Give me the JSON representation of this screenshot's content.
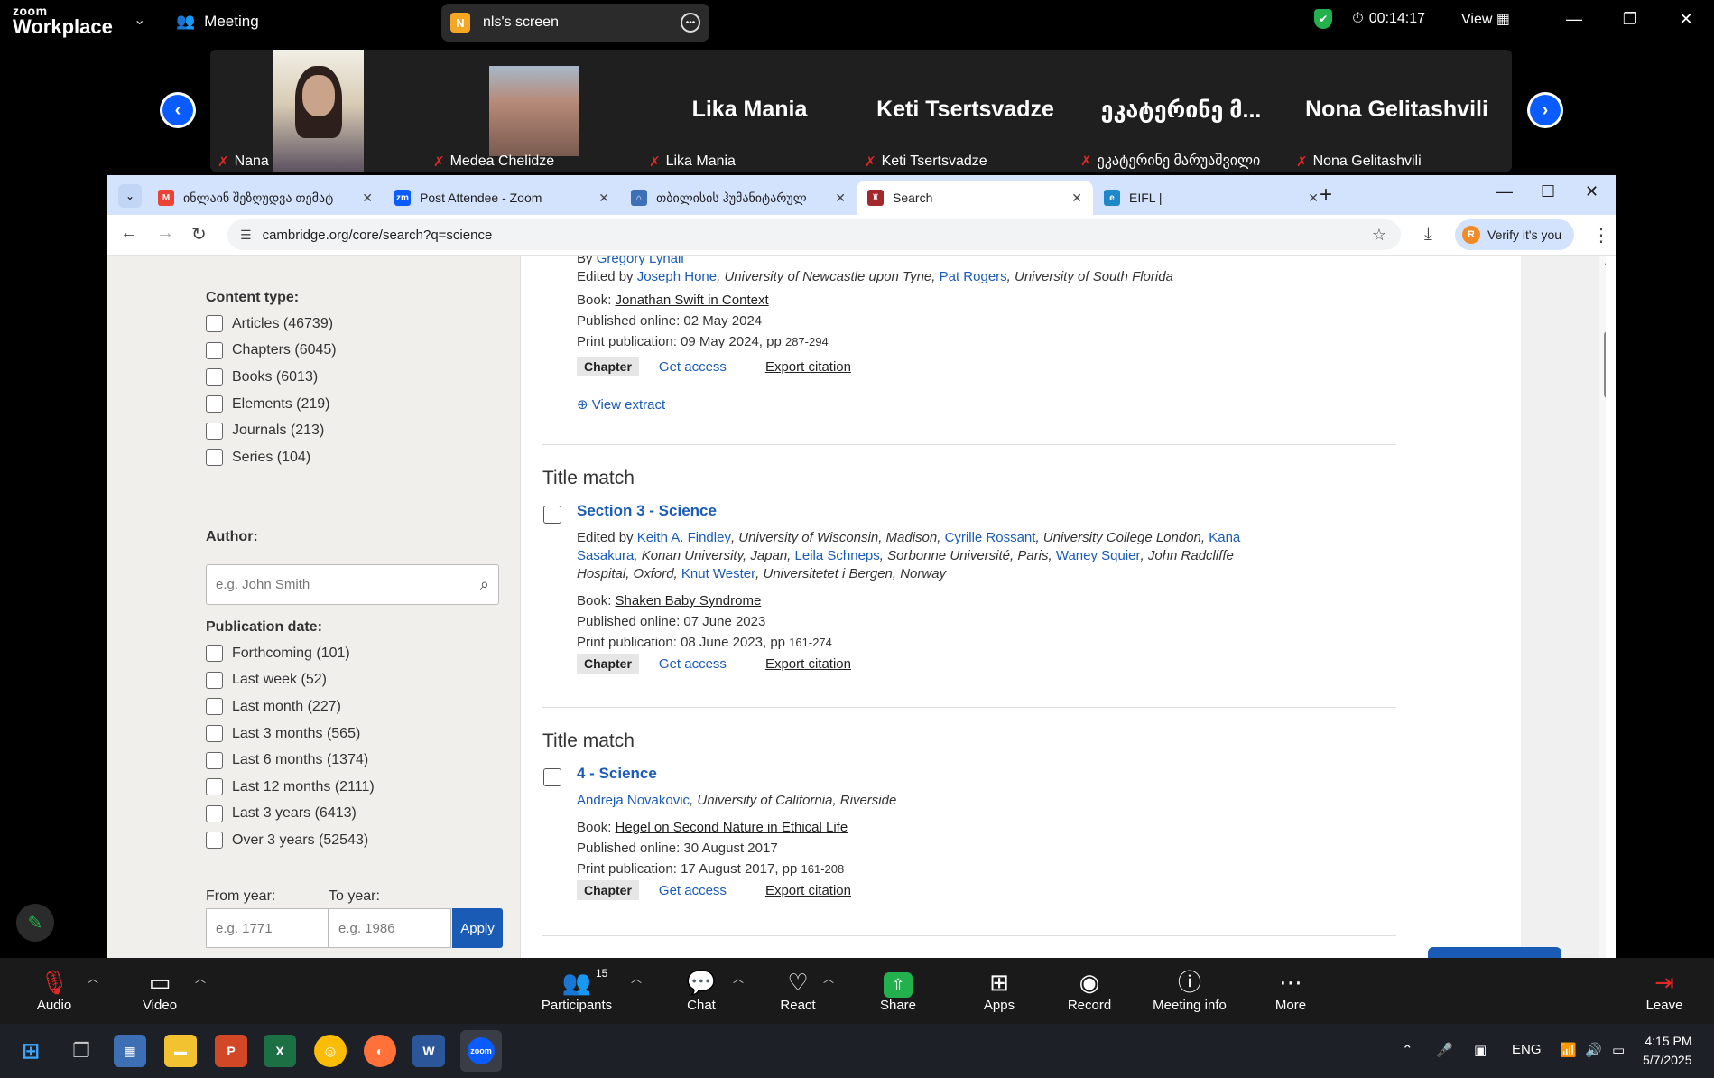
{
  "zoom": {
    "logo_small": "zoom",
    "logo_big": "Workplace",
    "meeting_label": "Meeting",
    "share_initial": "N",
    "share_title": "nls's screen",
    "timer": "00:14:17",
    "view_label": "View",
    "participants": [
      {
        "label": "Nana",
        "big_name": ""
      },
      {
        "label": "Medea Chelidze",
        "big_name": ""
      },
      {
        "label": "Lika Mania",
        "big_name": "Lika Mania"
      },
      {
        "label": "Keti Tsertsvadze",
        "big_name": "Keti Tsertsvadze"
      },
      {
        "label": "ეკატერინე მარუაშვილი",
        "big_name": "ეკატერინე მ..."
      },
      {
        "label": "Nona Gelitashvili",
        "big_name": "Nona Gelitashvili"
      }
    ],
    "toolbar": {
      "audio": "Audio",
      "video": "Video",
      "participants": "Participants",
      "participants_count": "15",
      "chat": "Chat",
      "react": "React",
      "share": "Share",
      "apps": "Apps",
      "record": "Record",
      "meeting_info": "Meeting info",
      "more": "More",
      "leave": "Leave"
    }
  },
  "browser": {
    "tabs": [
      {
        "title": "ინლაინ შეზღუდვა თემატ",
        "icon": "gmail-icon",
        "color": "#ea4335"
      },
      {
        "title": "Post Attendee - Zoom",
        "icon": "zoom-icon",
        "color": "#0b5cff"
      },
      {
        "title": "თბილისის ჰუმანიტარულ",
        "icon": "university-icon",
        "color": "#3b6fb6"
      },
      {
        "title": "Search",
        "icon": "cambridge-icon",
        "color": "#a3282e"
      },
      {
        "title": "EIFL |",
        "icon": "eifl-icon",
        "color": "#1e88c8"
      }
    ],
    "url": "cambridge.org/core/search?q=science",
    "verify_initial": "R",
    "verify_label": "Verify it's you"
  },
  "sidebar": {
    "content_type_heading": "Content type:",
    "content_types": [
      "Articles (46739)",
      "Chapters (6045)",
      "Books (6013)",
      "Elements (219)",
      "Journals (213)",
      "Series (104)"
    ],
    "author_heading": "Author:",
    "author_placeholder": "e.g. John Smith",
    "pubdate_heading": "Publication date:",
    "pubdates": [
      "Forthcoming (101)",
      "Last week (52)",
      "Last month (227)",
      "Last 3 months (565)",
      "Last 6 months (1374)",
      "Last 12 months (2111)",
      "Last 3 years (6413)",
      "Over 3 years (52543)"
    ],
    "from_label": "From year:",
    "from_placeholder": "e.g. 1771",
    "to_label": "To year:",
    "to_placeholder": "e.g. 1986",
    "apply_label": "Apply"
  },
  "results": {
    "r0": {
      "by_prefix": "By",
      "by_author": "Gregory Lynall",
      "edited_prefix": "Edited by",
      "editor1": "Joseph Hone",
      "editor1_aff": ", University of Newcastle upon Tyne,",
      "editor2": "Pat Rogers",
      "editor2_aff": ", University of South Florida",
      "book_prefix": "Book:",
      "book": "Jonathan Swift in Context",
      "published_online": "Published online: 02 May 2024",
      "print_pub": "Print publication: 09 May 2024, pp",
      "pages": "287-294",
      "badge": "Chapter",
      "get_access": "Get access",
      "export": "Export citation",
      "view_extract": "View extract"
    },
    "r1": {
      "match": "Title match",
      "title": "Section 3 - Science",
      "edited_prefix": "Edited by",
      "e1": "Keith A. Findley",
      "e1_aff": ", University of Wisconsin, Madison,",
      "e2": "Cyrille Rossant",
      "e2_aff": ", University College London,",
      "e3a": "Kana",
      "e3b": "Sasakura",
      "e3_aff": ", Konan University, Japan,",
      "e4": "Leila Schneps",
      "e4_aff": ", Sorbonne Université, Paris,",
      "e5": "Waney Squier",
      "e5_aff": ", John Radcliffe",
      "e5_aff2": "Hospital, Oxford,",
      "e6": "Knut Wester",
      "e6_aff": ", Universitetet i Bergen, Norway",
      "book_prefix": "Book:",
      "book": "Shaken Baby Syndrome",
      "published_online": "Published online: 07 June 2023",
      "print_pub": "Print publication: 08 June 2023, pp",
      "pages": "161-274",
      "badge": "Chapter",
      "get_access": "Get access",
      "export": "Export citation"
    },
    "r2": {
      "match": "Title match",
      "title": "4 - Science",
      "author": "Andreja Novakovic",
      "author_aff": ", University of California, Riverside",
      "book_prefix": "Book:",
      "book": "Hegel on Second Nature in Ethical Life",
      "published_online": "Published online: 30 August 2017",
      "print_pub": "Print publication: 17 August 2017, pp",
      "pages": "161-208",
      "badge": "Chapter",
      "get_access": "Get access",
      "export": "Export citation"
    }
  },
  "taskbar": {
    "lang": "ENG",
    "time": "4:15 PM",
    "date": "5/7/2025"
  }
}
